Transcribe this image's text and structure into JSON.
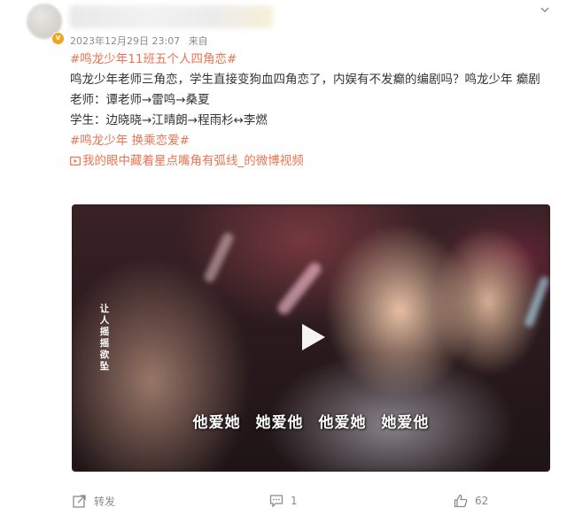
{
  "post": {
    "timestamp": "2023年12月29日 23:07",
    "source_prefix": "来自",
    "content": {
      "hashtag1": "#鸣龙少年11班五个人四角恋#",
      "text1": "鸣龙少年老师三角恋，学生直接变狗血四角恋了，内娱有不发癫的编剧吗？鸣龙少年 癫剧",
      "teachers_line": "老师：谭老师→雷鸣→桑夏",
      "students_line": "学生：边晓晓→江晴朗→程雨杉↔李燃",
      "hashtags2": "#鸣龙少年 换乘恋爱#",
      "video_link": "我的眼中藏着星点嘴角有弧线_的微博视频"
    },
    "video": {
      "vertical_caption": "让人摇摇欲坠",
      "subtitle": "他爱她 她爱他 他爱她 她爱他"
    }
  },
  "footer": {
    "repost_label": "转发",
    "comment_count": "1",
    "like_count": "62"
  },
  "icons": {
    "verified": "verified-badge-icon",
    "chevron": "chevron-down-icon",
    "video_link": "video-link-icon",
    "play": "play-icon",
    "repost": "repost-icon",
    "comment": "comment-icon",
    "like": "like-icon"
  },
  "colors": {
    "accent": "#eb7350",
    "meta": "#8b8b8b",
    "verified": "#f3a31c"
  }
}
